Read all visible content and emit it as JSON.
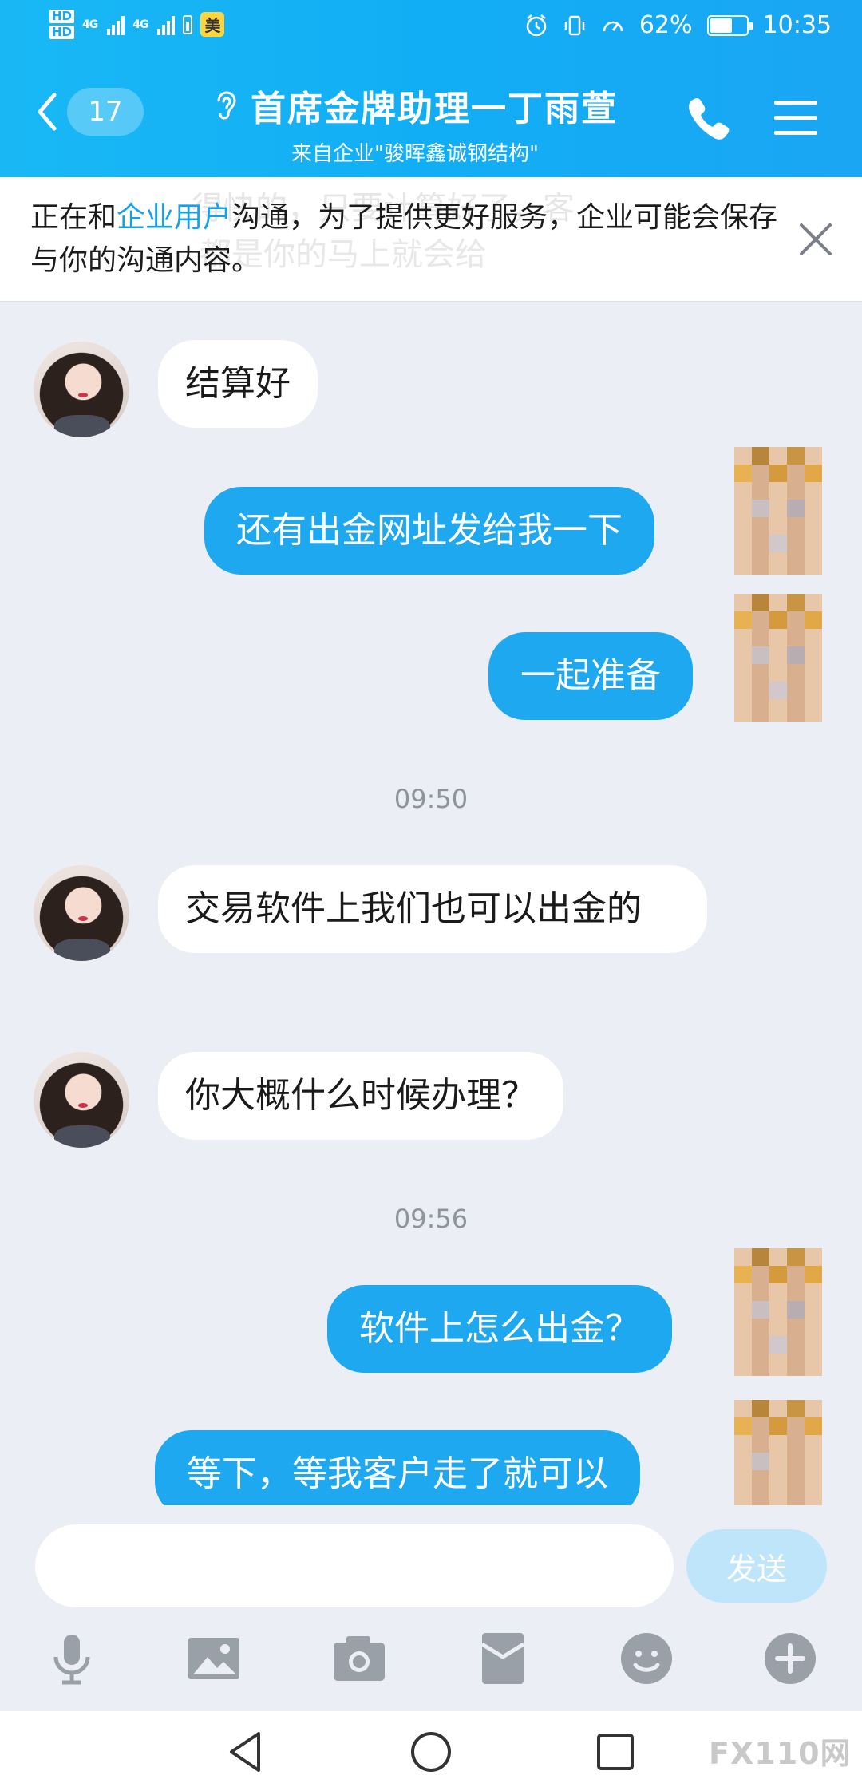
{
  "status_bar": {
    "hd1": "HD",
    "hd2": "HD",
    "net1": "4G",
    "net2": "4G",
    "app_badge": "美",
    "battery_percent": "62%",
    "battery_level": 0.62,
    "time": "10:35"
  },
  "header": {
    "unread_count": "17",
    "title": "首席金牌助理一丁雨萱",
    "subtitle": "来自企业\"骏晖鑫诚钢结构\""
  },
  "notice": {
    "text_before": "正在和",
    "link_text": "企业用户",
    "text_after": "沟通，为了提供更好服务，企业可能会保存与你的沟通内容。",
    "ghost_line1": "得快的，只要计算好了，客",
    "ghost_line2": "都是你的马上就会给"
  },
  "messages": [
    {
      "side": "left",
      "text": "结算好"
    },
    {
      "side": "right",
      "text": "还有出金网址发给我一下"
    },
    {
      "side": "right",
      "text": "一起准备"
    },
    {
      "time": "09:50"
    },
    {
      "side": "left",
      "text": "交易软件上我们也可以出金的"
    },
    {
      "side": "left",
      "text": "你大概什么时候办理？"
    },
    {
      "time": "09:56"
    },
    {
      "side": "right",
      "text": "软件上怎么出金？"
    },
    {
      "side": "right",
      "text": "等下，等我客户走了就可以"
    }
  ],
  "input": {
    "value": "",
    "send_label": "发送"
  },
  "toolbar_icons": [
    "microphone-icon",
    "image-icon",
    "camera-icon",
    "red-packet-icon",
    "emoji-icon",
    "plus-icon"
  ],
  "watermark": "FX110网",
  "colors": {
    "header_blue": "#12aef5",
    "bubble_blue": "#1ea8f0",
    "link_blue": "#14a0ec",
    "chat_bg": "#eceef5"
  }
}
